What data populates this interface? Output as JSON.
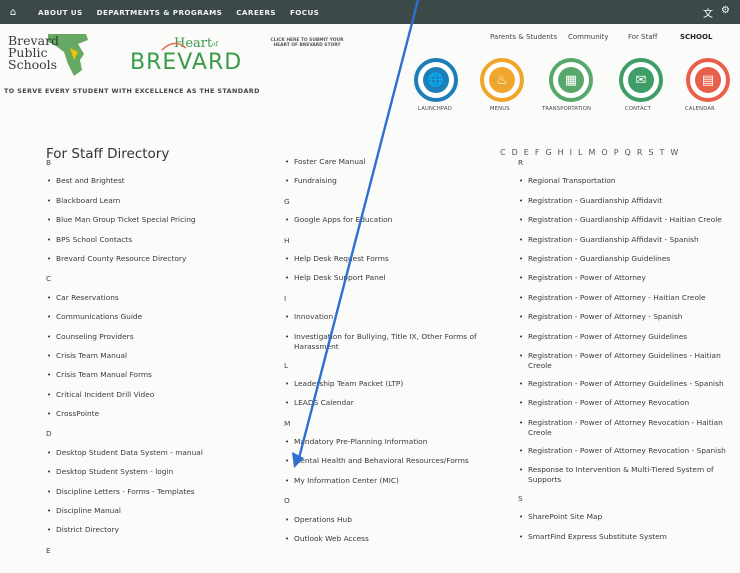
{
  "nav": {
    "items": [
      "ABOUT US",
      "DEPARTMENTS & PROGRAMS",
      "CAREERS",
      "FOCUS"
    ],
    "icons": [
      "home-icon",
      "translate-icon",
      "gear-icon"
    ]
  },
  "header": {
    "bps_logo_lines": [
      "Brevard",
      "Public",
      "Schools"
    ],
    "heart_logo_line1": "Heart",
    "heart_logo_of": "of",
    "heart_logo_line2": "BREVARD",
    "click_here": "CLICK HERE TO SUBMIT YOUR HEART OF BREVARD STORY",
    "tagline": "TO SERVE EVERY STUDENT WITH EXCELLENCE AS THE STANDARD",
    "util_links": [
      "Parents & Students",
      "Community",
      "For Staff",
      "SCHOOL"
    ]
  },
  "quick_links": [
    {
      "label": "LAUNCHPAD",
      "icon": "globe-icon",
      "color": "#1e7eb8"
    },
    {
      "label": "MENUS",
      "icon": "fork-knife-icon",
      "color": "#f0a52c"
    },
    {
      "label": "TRANSPORTATION",
      "icon": "bus-icon",
      "color": "#57a86a"
    },
    {
      "label": "CONTACT",
      "icon": "envelope-icon",
      "color": "#3f9d67"
    },
    {
      "label": "CALENDAR",
      "icon": "calendar-icon",
      "color": "#e8604c"
    }
  ],
  "directory": {
    "title": "For Staff Directory",
    "alphabet": [
      "C",
      "D",
      "E",
      "F",
      "G",
      "H",
      "I",
      "L",
      "M",
      "O",
      "P",
      "Q",
      "R",
      "S",
      "T",
      "W"
    ],
    "col1": [
      {
        "t": "letter",
        "v": "B"
      },
      {
        "t": "item",
        "v": "Best and Brightest"
      },
      {
        "t": "item",
        "v": "Blackboard Learn"
      },
      {
        "t": "item",
        "v": "Blue Man Group Ticket Special Pricing"
      },
      {
        "t": "item",
        "v": "BPS School Contacts"
      },
      {
        "t": "item",
        "v": "Brevard County Resource Directory"
      },
      {
        "t": "letter",
        "v": "C"
      },
      {
        "t": "item",
        "v": "Car Reservations"
      },
      {
        "t": "item",
        "v": "Communications Guide"
      },
      {
        "t": "item",
        "v": "Counseling Providers"
      },
      {
        "t": "item",
        "v": "Crisis Team Manual"
      },
      {
        "t": "item",
        "v": "Crisis Team Manual Forms"
      },
      {
        "t": "item",
        "v": "Critical Incident Drill Video"
      },
      {
        "t": "item",
        "v": "CrossPointe"
      },
      {
        "t": "letter",
        "v": "D"
      },
      {
        "t": "item",
        "v": "Desktop Student Data System - manual"
      },
      {
        "t": "item",
        "v": "Desktop Student System - login"
      },
      {
        "t": "item",
        "v": "Discipline Letters - Forms - Templates"
      },
      {
        "t": "item",
        "v": "Discipline Manual"
      },
      {
        "t": "item",
        "v": "District Directory"
      },
      {
        "t": "letter",
        "v": "E"
      }
    ],
    "col2": [
      {
        "t": "item",
        "v": "Foster Care Manual"
      },
      {
        "t": "item",
        "v": "Fundraising"
      },
      {
        "t": "letter",
        "v": "G"
      },
      {
        "t": "item",
        "v": "Google Apps for Education"
      },
      {
        "t": "letter",
        "v": "H"
      },
      {
        "t": "item",
        "v": "Help Desk Request Forms"
      },
      {
        "t": "item",
        "v": "Help Desk Support Panel"
      },
      {
        "t": "letter",
        "v": "I"
      },
      {
        "t": "item",
        "v": "Innovation"
      },
      {
        "t": "item2",
        "v": "Investigation for Bullying, Title IX, Other Forms of Harassment"
      },
      {
        "t": "letter",
        "v": "L"
      },
      {
        "t": "item",
        "v": "Leadership Team Packet (LTP)"
      },
      {
        "t": "item",
        "v": "LEADS Calendar"
      },
      {
        "t": "letter",
        "v": "M"
      },
      {
        "t": "item",
        "v": "Mandatory Pre-Planning Information"
      },
      {
        "t": "item",
        "v": "Mental Health and Behavioral Resources/Forms"
      },
      {
        "t": "item",
        "v": "My Information Center (MIC)"
      },
      {
        "t": "letter",
        "v": "O"
      },
      {
        "t": "item",
        "v": "Operations Hub"
      },
      {
        "t": "item",
        "v": "Outlook Web Access"
      }
    ],
    "col3": [
      {
        "t": "letter",
        "v": "R"
      },
      {
        "t": "item",
        "v": "Regional Transportation"
      },
      {
        "t": "item",
        "v": "Registration - Guardianship Affidavit"
      },
      {
        "t": "item",
        "v": "Registration - Guardianship Affidavit - Haitian Creole"
      },
      {
        "t": "item",
        "v": "Registration - Guardianship Affidavit - Spanish"
      },
      {
        "t": "item",
        "v": "Registration - Guardianship Guidelines"
      },
      {
        "t": "item",
        "v": "Registration - Power of Attorney"
      },
      {
        "t": "item",
        "v": "Registration - Power of Attorney - Haitian Creole"
      },
      {
        "t": "item",
        "v": "Registration - Power of Attorney - Spanish"
      },
      {
        "t": "item",
        "v": "Registration - Power of Attorney Guidelines"
      },
      {
        "t": "item2",
        "v": "Registration - Power of Attorney Guidelines - Haitian Creole"
      },
      {
        "t": "item",
        "v": "Registration - Power of Attorney Guidelines - Spanish"
      },
      {
        "t": "item",
        "v": "Registration - Power of Attorney Revocation"
      },
      {
        "t": "item2",
        "v": "Registration - Power of Attorney Revocation - Haitian Creole"
      },
      {
        "t": "item",
        "v": "Registration - Power of Attorney Revocation - Spanish"
      },
      {
        "t": "item2",
        "v": "Response to Intervention & Multi-Tiered System of Supports"
      },
      {
        "t": "letter",
        "v": "S"
      },
      {
        "t": "item",
        "v": "SharePoint Site Map"
      },
      {
        "t": "item",
        "v": "SmartFind Express Substitute System"
      }
    ]
  },
  "colors": {
    "nav_bg": "#3b4a49",
    "arrow": "#2f6fd0"
  }
}
